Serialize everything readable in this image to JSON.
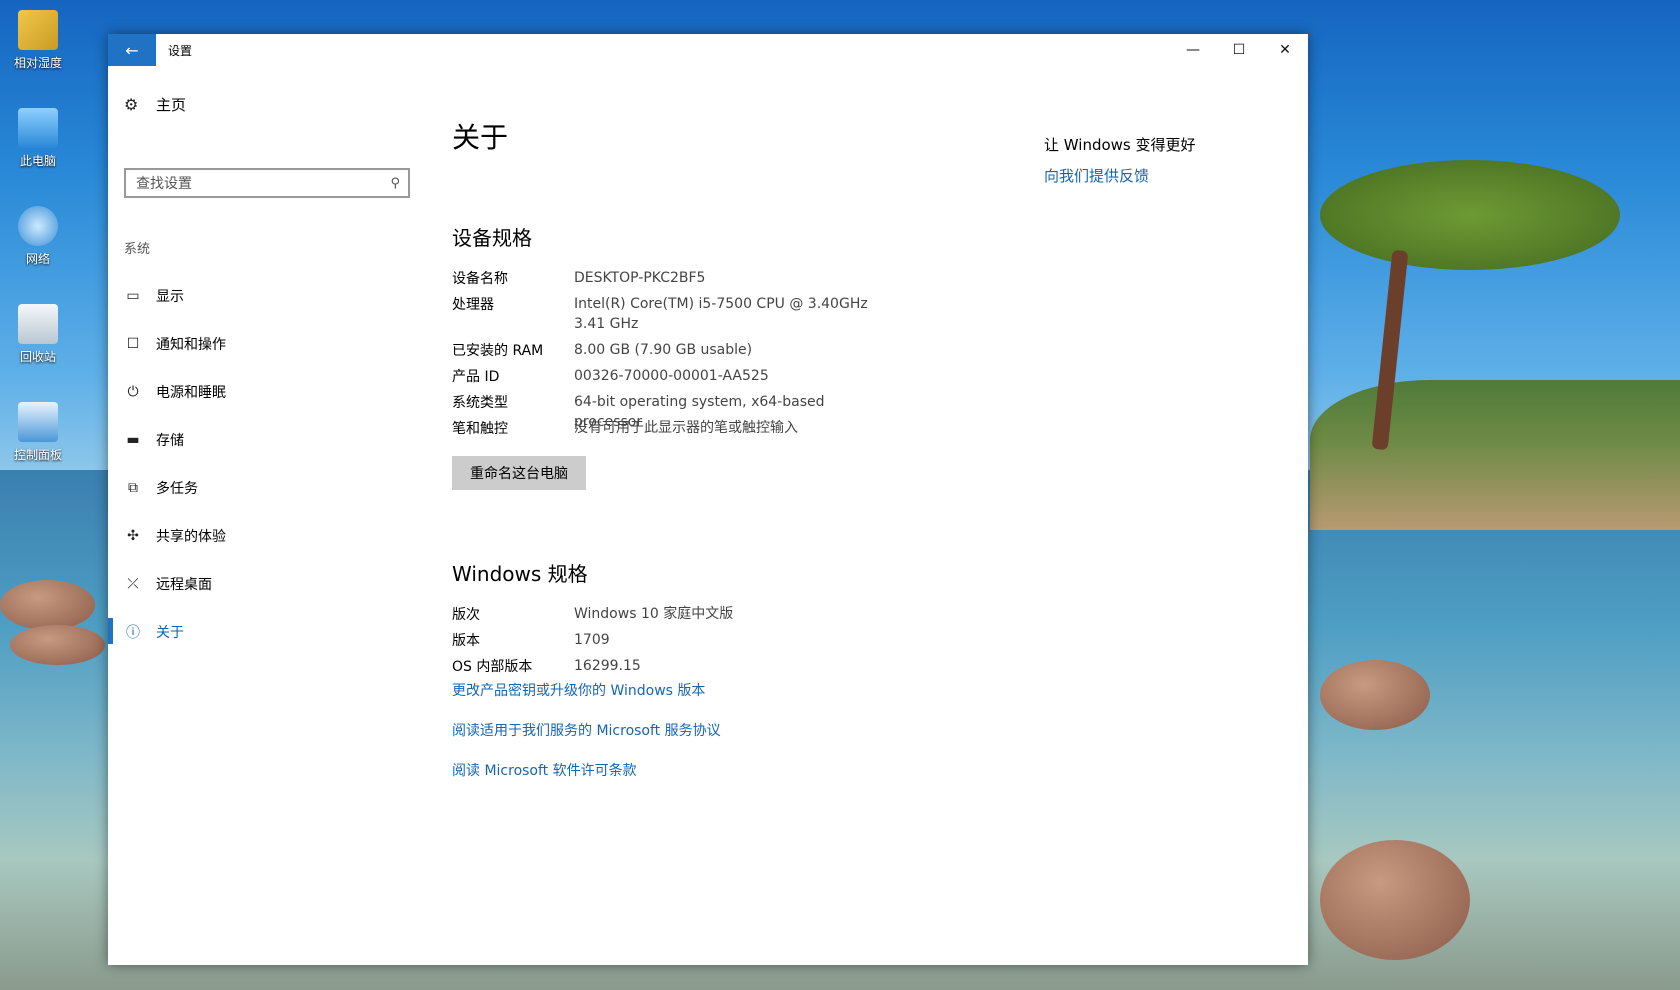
{
  "desktop": {
    "icons": [
      {
        "label": "相对湿度"
      },
      {
        "label": "此电脑"
      },
      {
        "label": "网络"
      },
      {
        "label": "回收站"
      },
      {
        "label": "控制面板"
      }
    ]
  },
  "window": {
    "title": "设置",
    "back_icon": "←",
    "controls": {
      "minimize": "—",
      "maximize": "☐",
      "close": "✕"
    }
  },
  "sidebar": {
    "home_label": "主页",
    "search_placeholder": "查找设置",
    "section_label": "系统",
    "items": [
      {
        "label": "显示",
        "icon": "display-icon"
      },
      {
        "label": "通知和操作",
        "icon": "notification-icon"
      },
      {
        "label": "电源和睡眠",
        "icon": "power-icon"
      },
      {
        "label": "存储",
        "icon": "storage-icon"
      },
      {
        "label": "多任务",
        "icon": "multitask-icon"
      },
      {
        "label": "共享的体验",
        "icon": "share-icon"
      },
      {
        "label": "远程桌面",
        "icon": "remote-icon"
      },
      {
        "label": "关于",
        "icon": "info-icon",
        "active": true
      }
    ]
  },
  "main": {
    "page_title": "关于",
    "device_spec": {
      "heading": "设备规格",
      "rows": [
        {
          "key": "设备名称",
          "value": "DESKTOP-PKC2BF5"
        },
        {
          "key": "处理器",
          "value": "Intel(R) Core(TM) i5-7500 CPU @ 3.40GHz   3.41 GHz"
        },
        {
          "key": "已安装的 RAM",
          "value": "8.00 GB (7.90 GB usable)"
        },
        {
          "key": "产品 ID",
          "value": "00326-70000-00001-AA525"
        },
        {
          "key": "系统类型",
          "value": "64-bit operating system, x64-based processor"
        },
        {
          "key": "笔和触控",
          "value": "没有可用于此显示器的笔或触控输入"
        }
      ],
      "rename_button": "重命名这台电脑"
    },
    "windows_spec": {
      "heading": "Windows 规格",
      "rows": [
        {
          "key": "版次",
          "value": "Windows 10 家庭中文版"
        },
        {
          "key": "版本",
          "value": "1709"
        },
        {
          "key": "OS 内部版本",
          "value": "16299.15"
        }
      ],
      "links": [
        "更改产品密钥或升级你的 Windows 版本",
        "阅读适用于我们服务的 Microsoft 服务协议",
        "阅读 Microsoft 软件许可条款"
      ]
    }
  },
  "aside": {
    "title": "让 Windows 变得更好",
    "link": "向我们提供反馈"
  }
}
